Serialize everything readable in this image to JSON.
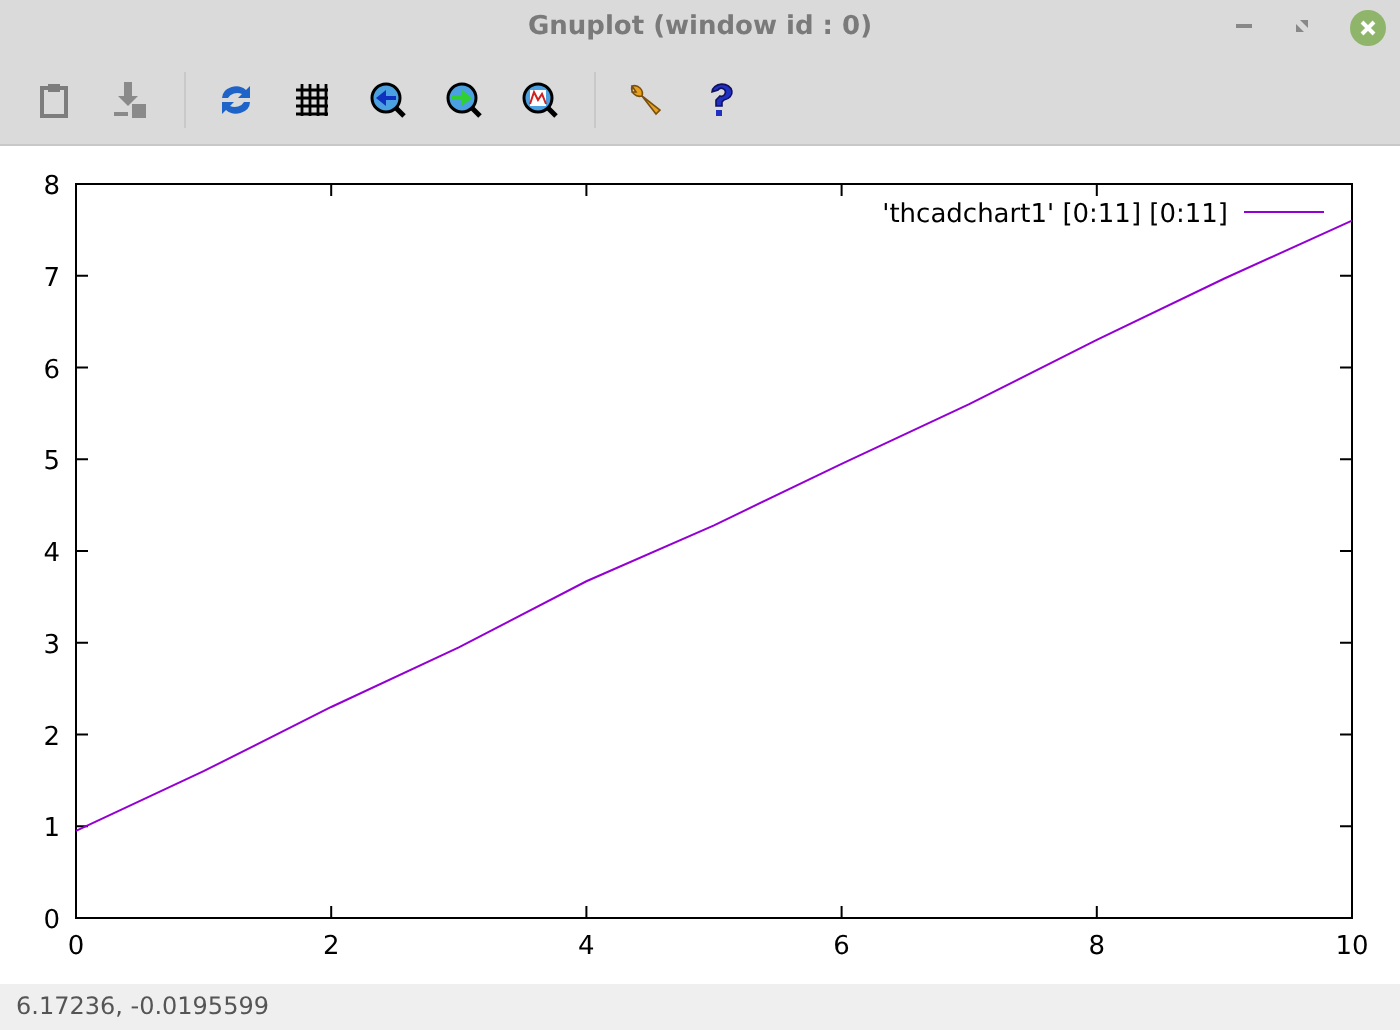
{
  "window": {
    "title": "Gnuplot (window id : 0)"
  },
  "toolbar": [
    {
      "kind": "copy"
    },
    {
      "kind": "export"
    },
    {
      "kind": "replot"
    },
    {
      "kind": "grid"
    },
    {
      "kind": "zoom_back"
    },
    {
      "kind": "zoom_forward"
    },
    {
      "kind": "autoscale"
    },
    {
      "kind": "settings"
    },
    {
      "kind": "help"
    }
  ],
  "plot": {
    "chart_data": {
      "type": "line",
      "x": [
        0,
        1,
        2,
        3,
        4,
        5,
        6,
        7,
        8,
        9,
        10
      ],
      "series": [
        {
          "name": "'thcadchart1' [0:11] [0:11]",
          "color": "#9400d3",
          "values": [
            0.95,
            1.6,
            2.3,
            2.95,
            3.67,
            4.28,
            4.95,
            5.6,
            6.3,
            6.97,
            7.6
          ]
        }
      ],
      "xlim": [
        0,
        10
      ],
      "ylim": [
        0,
        8
      ],
      "xticks": [
        0,
        2,
        4,
        6,
        8,
        10
      ],
      "yticks": [
        0,
        1,
        2,
        3,
        4,
        5,
        6,
        7,
        8
      ]
    }
  },
  "status_bar": "6.17236, -0.0195599"
}
